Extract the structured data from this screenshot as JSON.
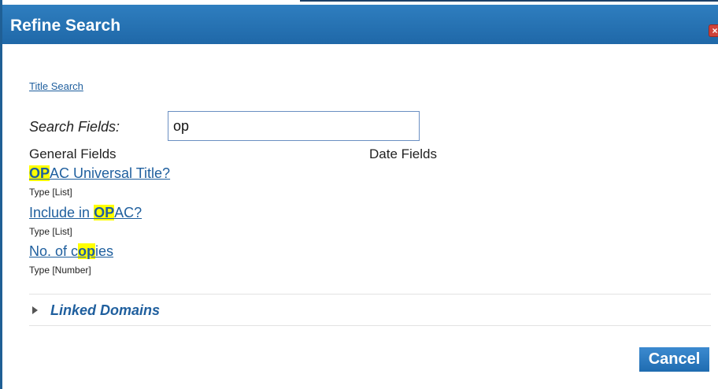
{
  "dialog": {
    "title": "Refine Search",
    "close_label": "×"
  },
  "title_search_link": "Title Search",
  "search": {
    "label": "Search Fields:",
    "value": "op"
  },
  "columns": {
    "general": "General Fields",
    "date": "Date Fields"
  },
  "fields": [
    {
      "before": "",
      "match": "OP",
      "after": "AC Universal Title?",
      "type": "Type [List]"
    },
    {
      "before": "Include in ",
      "match": "OP",
      "after": "AC?",
      "type": "Type [List]"
    },
    {
      "before": "No. of c",
      "match": "op",
      "after": "ies",
      "type": "Type [Number]"
    }
  ],
  "linked_domains": "Linked Domains",
  "cancel_label": "Cancel",
  "colors": {
    "titlebar": "#1f68a8",
    "link": "#1f5f9e",
    "highlight": "#ffff00",
    "close": "#d0443a"
  }
}
